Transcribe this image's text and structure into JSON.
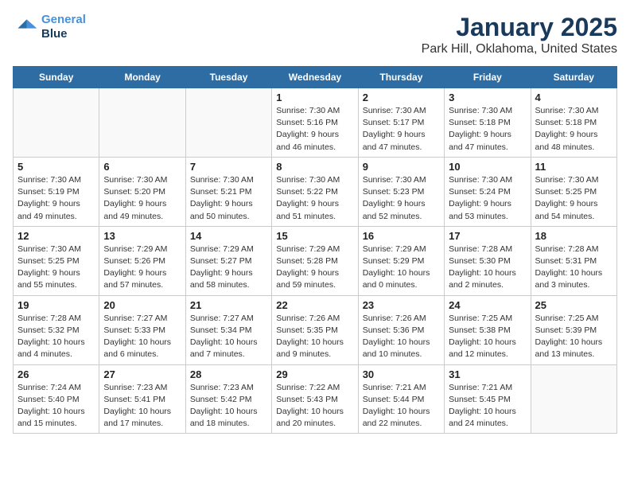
{
  "header": {
    "logo_line1": "General",
    "logo_line2": "Blue",
    "title": "January 2025",
    "subtitle": "Park Hill, Oklahoma, United States"
  },
  "weekdays": [
    "Sunday",
    "Monday",
    "Tuesday",
    "Wednesday",
    "Thursday",
    "Friday",
    "Saturday"
  ],
  "weeks": [
    [
      {
        "day": "",
        "info": ""
      },
      {
        "day": "",
        "info": ""
      },
      {
        "day": "",
        "info": ""
      },
      {
        "day": "1",
        "info": "Sunrise: 7:30 AM\nSunset: 5:16 PM\nDaylight: 9 hours\nand 46 minutes."
      },
      {
        "day": "2",
        "info": "Sunrise: 7:30 AM\nSunset: 5:17 PM\nDaylight: 9 hours\nand 47 minutes."
      },
      {
        "day": "3",
        "info": "Sunrise: 7:30 AM\nSunset: 5:18 PM\nDaylight: 9 hours\nand 47 minutes."
      },
      {
        "day": "4",
        "info": "Sunrise: 7:30 AM\nSunset: 5:18 PM\nDaylight: 9 hours\nand 48 minutes."
      }
    ],
    [
      {
        "day": "5",
        "info": "Sunrise: 7:30 AM\nSunset: 5:19 PM\nDaylight: 9 hours\nand 49 minutes."
      },
      {
        "day": "6",
        "info": "Sunrise: 7:30 AM\nSunset: 5:20 PM\nDaylight: 9 hours\nand 49 minutes."
      },
      {
        "day": "7",
        "info": "Sunrise: 7:30 AM\nSunset: 5:21 PM\nDaylight: 9 hours\nand 50 minutes."
      },
      {
        "day": "8",
        "info": "Sunrise: 7:30 AM\nSunset: 5:22 PM\nDaylight: 9 hours\nand 51 minutes."
      },
      {
        "day": "9",
        "info": "Sunrise: 7:30 AM\nSunset: 5:23 PM\nDaylight: 9 hours\nand 52 minutes."
      },
      {
        "day": "10",
        "info": "Sunrise: 7:30 AM\nSunset: 5:24 PM\nDaylight: 9 hours\nand 53 minutes."
      },
      {
        "day": "11",
        "info": "Sunrise: 7:30 AM\nSunset: 5:25 PM\nDaylight: 9 hours\nand 54 minutes."
      }
    ],
    [
      {
        "day": "12",
        "info": "Sunrise: 7:30 AM\nSunset: 5:25 PM\nDaylight: 9 hours\nand 55 minutes."
      },
      {
        "day": "13",
        "info": "Sunrise: 7:29 AM\nSunset: 5:26 PM\nDaylight: 9 hours\nand 57 minutes."
      },
      {
        "day": "14",
        "info": "Sunrise: 7:29 AM\nSunset: 5:27 PM\nDaylight: 9 hours\nand 58 minutes."
      },
      {
        "day": "15",
        "info": "Sunrise: 7:29 AM\nSunset: 5:28 PM\nDaylight: 9 hours\nand 59 minutes."
      },
      {
        "day": "16",
        "info": "Sunrise: 7:29 AM\nSunset: 5:29 PM\nDaylight: 10 hours\nand 0 minutes."
      },
      {
        "day": "17",
        "info": "Sunrise: 7:28 AM\nSunset: 5:30 PM\nDaylight: 10 hours\nand 2 minutes."
      },
      {
        "day": "18",
        "info": "Sunrise: 7:28 AM\nSunset: 5:31 PM\nDaylight: 10 hours\nand 3 minutes."
      }
    ],
    [
      {
        "day": "19",
        "info": "Sunrise: 7:28 AM\nSunset: 5:32 PM\nDaylight: 10 hours\nand 4 minutes."
      },
      {
        "day": "20",
        "info": "Sunrise: 7:27 AM\nSunset: 5:33 PM\nDaylight: 10 hours\nand 6 minutes."
      },
      {
        "day": "21",
        "info": "Sunrise: 7:27 AM\nSunset: 5:34 PM\nDaylight: 10 hours\nand 7 minutes."
      },
      {
        "day": "22",
        "info": "Sunrise: 7:26 AM\nSunset: 5:35 PM\nDaylight: 10 hours\nand 9 minutes."
      },
      {
        "day": "23",
        "info": "Sunrise: 7:26 AM\nSunset: 5:36 PM\nDaylight: 10 hours\nand 10 minutes."
      },
      {
        "day": "24",
        "info": "Sunrise: 7:25 AM\nSunset: 5:38 PM\nDaylight: 10 hours\nand 12 minutes."
      },
      {
        "day": "25",
        "info": "Sunrise: 7:25 AM\nSunset: 5:39 PM\nDaylight: 10 hours\nand 13 minutes."
      }
    ],
    [
      {
        "day": "26",
        "info": "Sunrise: 7:24 AM\nSunset: 5:40 PM\nDaylight: 10 hours\nand 15 minutes."
      },
      {
        "day": "27",
        "info": "Sunrise: 7:23 AM\nSunset: 5:41 PM\nDaylight: 10 hours\nand 17 minutes."
      },
      {
        "day": "28",
        "info": "Sunrise: 7:23 AM\nSunset: 5:42 PM\nDaylight: 10 hours\nand 18 minutes."
      },
      {
        "day": "29",
        "info": "Sunrise: 7:22 AM\nSunset: 5:43 PM\nDaylight: 10 hours\nand 20 minutes."
      },
      {
        "day": "30",
        "info": "Sunrise: 7:21 AM\nSunset: 5:44 PM\nDaylight: 10 hours\nand 22 minutes."
      },
      {
        "day": "31",
        "info": "Sunrise: 7:21 AM\nSunset: 5:45 PM\nDaylight: 10 hours\nand 24 minutes."
      },
      {
        "day": "",
        "info": ""
      }
    ]
  ]
}
